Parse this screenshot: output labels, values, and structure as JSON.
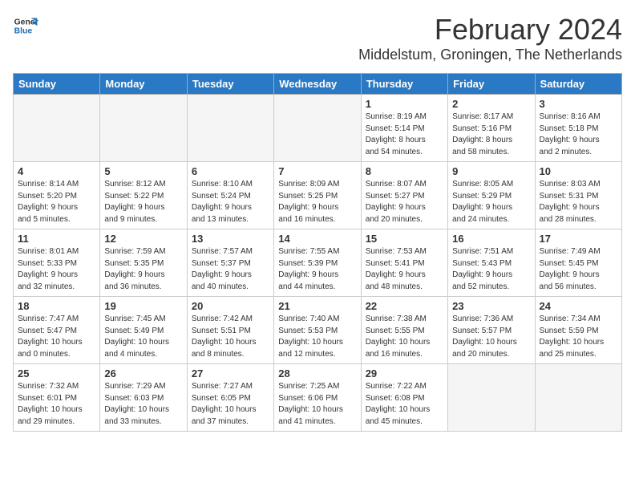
{
  "logo": {
    "line1": "General",
    "line2": "Blue"
  },
  "title": "February 2024",
  "subtitle": "Middelstum, Groningen, The Netherlands",
  "days_of_week": [
    "Sunday",
    "Monday",
    "Tuesday",
    "Wednesday",
    "Thursday",
    "Friday",
    "Saturday"
  ],
  "weeks": [
    [
      {
        "day": "",
        "info": ""
      },
      {
        "day": "",
        "info": ""
      },
      {
        "day": "",
        "info": ""
      },
      {
        "day": "",
        "info": ""
      },
      {
        "day": "1",
        "info": "Sunrise: 8:19 AM\nSunset: 5:14 PM\nDaylight: 8 hours\nand 54 minutes."
      },
      {
        "day": "2",
        "info": "Sunrise: 8:17 AM\nSunset: 5:16 PM\nDaylight: 8 hours\nand 58 minutes."
      },
      {
        "day": "3",
        "info": "Sunrise: 8:16 AM\nSunset: 5:18 PM\nDaylight: 9 hours\nand 2 minutes."
      }
    ],
    [
      {
        "day": "4",
        "info": "Sunrise: 8:14 AM\nSunset: 5:20 PM\nDaylight: 9 hours\nand 5 minutes."
      },
      {
        "day": "5",
        "info": "Sunrise: 8:12 AM\nSunset: 5:22 PM\nDaylight: 9 hours\nand 9 minutes."
      },
      {
        "day": "6",
        "info": "Sunrise: 8:10 AM\nSunset: 5:24 PM\nDaylight: 9 hours\nand 13 minutes."
      },
      {
        "day": "7",
        "info": "Sunrise: 8:09 AM\nSunset: 5:25 PM\nDaylight: 9 hours\nand 16 minutes."
      },
      {
        "day": "8",
        "info": "Sunrise: 8:07 AM\nSunset: 5:27 PM\nDaylight: 9 hours\nand 20 minutes."
      },
      {
        "day": "9",
        "info": "Sunrise: 8:05 AM\nSunset: 5:29 PM\nDaylight: 9 hours\nand 24 minutes."
      },
      {
        "day": "10",
        "info": "Sunrise: 8:03 AM\nSunset: 5:31 PM\nDaylight: 9 hours\nand 28 minutes."
      }
    ],
    [
      {
        "day": "11",
        "info": "Sunrise: 8:01 AM\nSunset: 5:33 PM\nDaylight: 9 hours\nand 32 minutes."
      },
      {
        "day": "12",
        "info": "Sunrise: 7:59 AM\nSunset: 5:35 PM\nDaylight: 9 hours\nand 36 minutes."
      },
      {
        "day": "13",
        "info": "Sunrise: 7:57 AM\nSunset: 5:37 PM\nDaylight: 9 hours\nand 40 minutes."
      },
      {
        "day": "14",
        "info": "Sunrise: 7:55 AM\nSunset: 5:39 PM\nDaylight: 9 hours\nand 44 minutes."
      },
      {
        "day": "15",
        "info": "Sunrise: 7:53 AM\nSunset: 5:41 PM\nDaylight: 9 hours\nand 48 minutes."
      },
      {
        "day": "16",
        "info": "Sunrise: 7:51 AM\nSunset: 5:43 PM\nDaylight: 9 hours\nand 52 minutes."
      },
      {
        "day": "17",
        "info": "Sunrise: 7:49 AM\nSunset: 5:45 PM\nDaylight: 9 hours\nand 56 minutes."
      }
    ],
    [
      {
        "day": "18",
        "info": "Sunrise: 7:47 AM\nSunset: 5:47 PM\nDaylight: 10 hours\nand 0 minutes."
      },
      {
        "day": "19",
        "info": "Sunrise: 7:45 AM\nSunset: 5:49 PM\nDaylight: 10 hours\nand 4 minutes."
      },
      {
        "day": "20",
        "info": "Sunrise: 7:42 AM\nSunset: 5:51 PM\nDaylight: 10 hours\nand 8 minutes."
      },
      {
        "day": "21",
        "info": "Sunrise: 7:40 AM\nSunset: 5:53 PM\nDaylight: 10 hours\nand 12 minutes."
      },
      {
        "day": "22",
        "info": "Sunrise: 7:38 AM\nSunset: 5:55 PM\nDaylight: 10 hours\nand 16 minutes."
      },
      {
        "day": "23",
        "info": "Sunrise: 7:36 AM\nSunset: 5:57 PM\nDaylight: 10 hours\nand 20 minutes."
      },
      {
        "day": "24",
        "info": "Sunrise: 7:34 AM\nSunset: 5:59 PM\nDaylight: 10 hours\nand 25 minutes."
      }
    ],
    [
      {
        "day": "25",
        "info": "Sunrise: 7:32 AM\nSunset: 6:01 PM\nDaylight: 10 hours\nand 29 minutes."
      },
      {
        "day": "26",
        "info": "Sunrise: 7:29 AM\nSunset: 6:03 PM\nDaylight: 10 hours\nand 33 minutes."
      },
      {
        "day": "27",
        "info": "Sunrise: 7:27 AM\nSunset: 6:05 PM\nDaylight: 10 hours\nand 37 minutes."
      },
      {
        "day": "28",
        "info": "Sunrise: 7:25 AM\nSunset: 6:06 PM\nDaylight: 10 hours\nand 41 minutes."
      },
      {
        "day": "29",
        "info": "Sunrise: 7:22 AM\nSunset: 6:08 PM\nDaylight: 10 hours\nand 45 minutes."
      },
      {
        "day": "",
        "info": ""
      },
      {
        "day": "",
        "info": ""
      }
    ]
  ]
}
